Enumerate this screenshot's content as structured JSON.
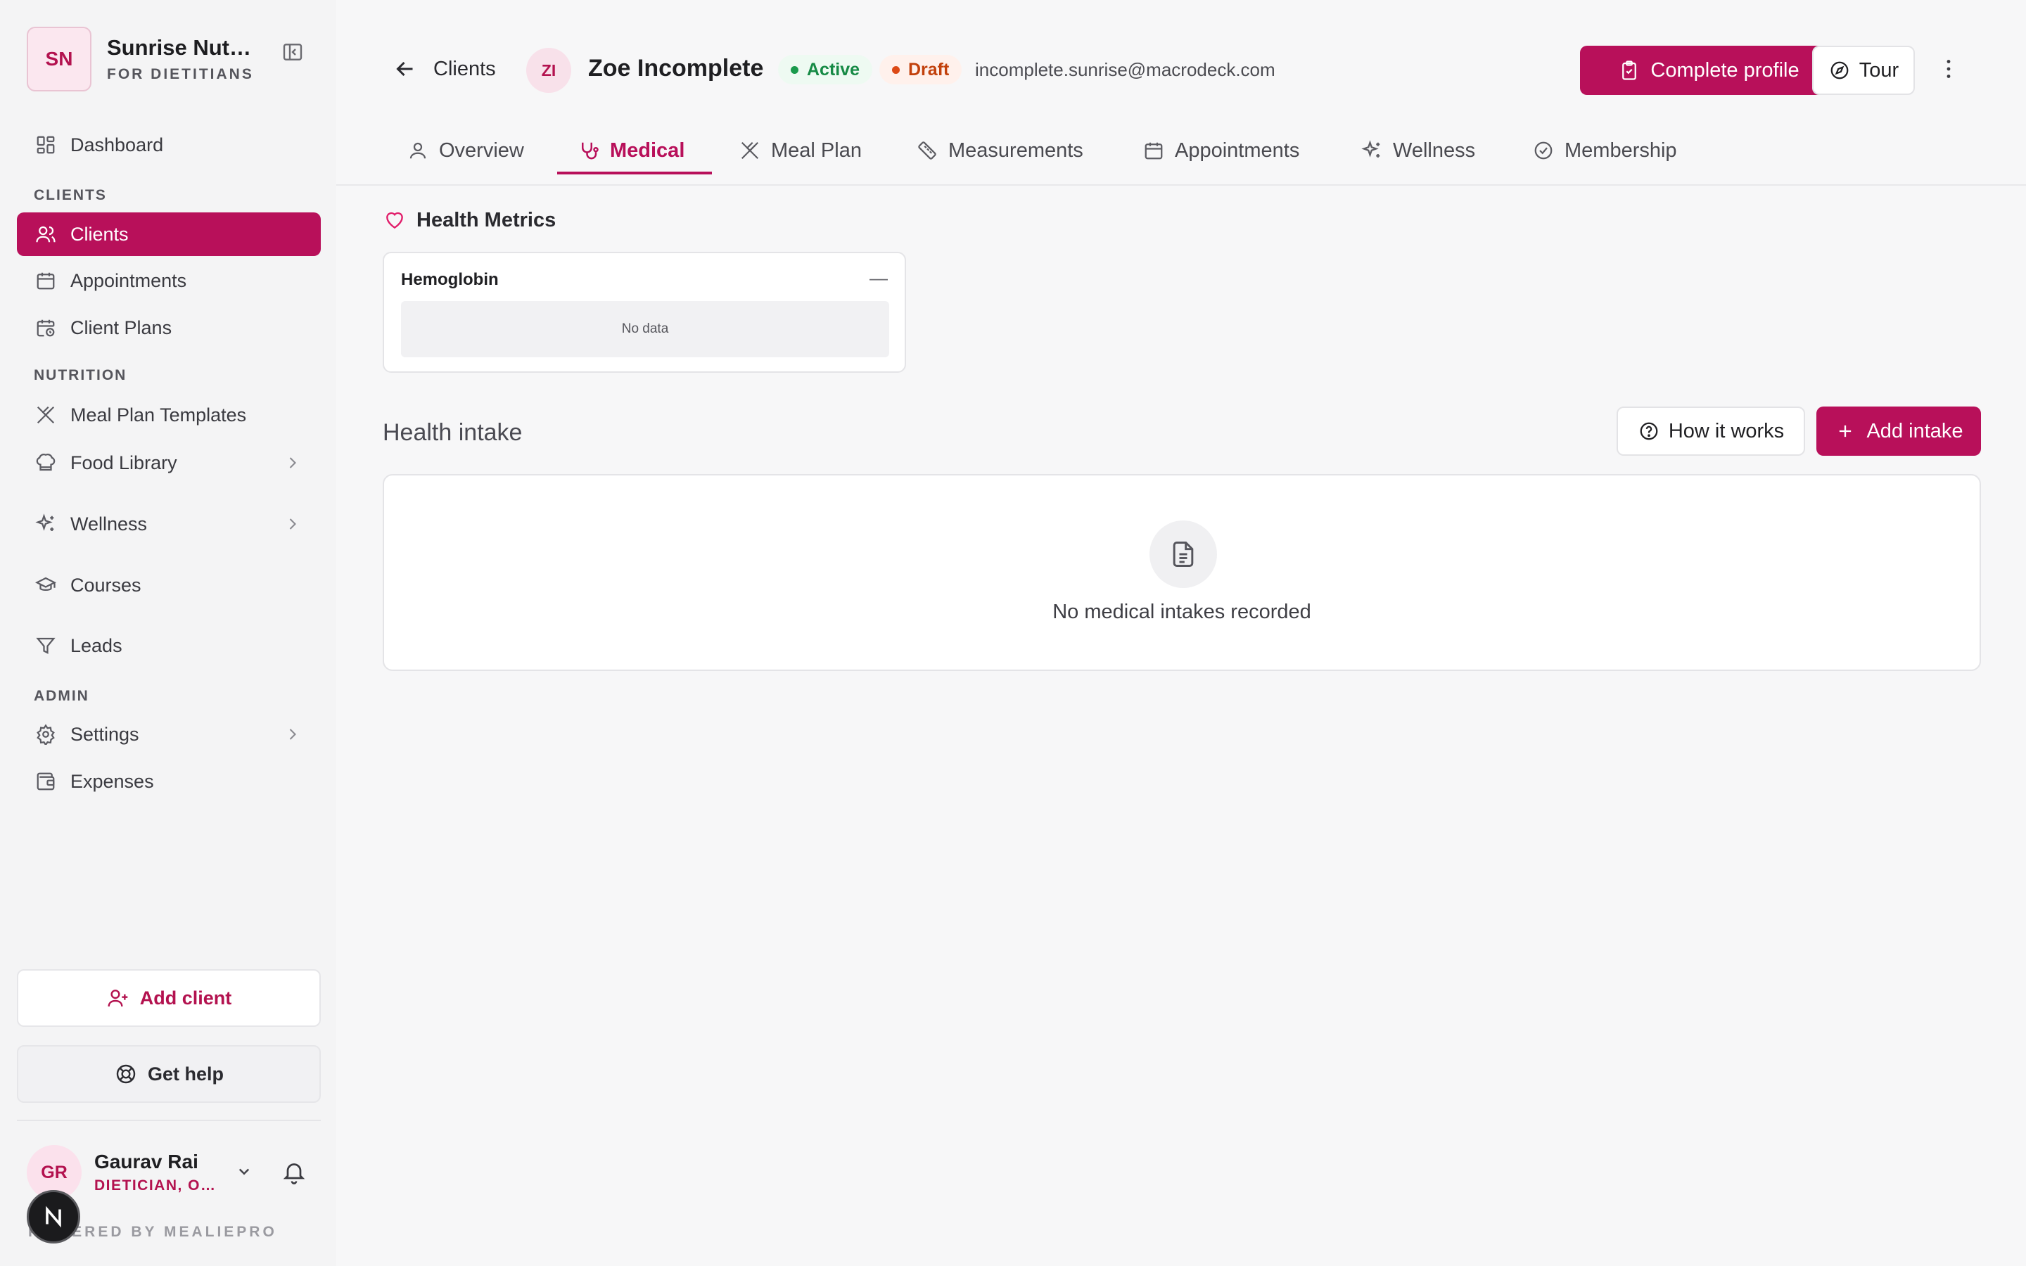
{
  "brand": {
    "initials": "SN",
    "name": "Sunrise Nutrition",
    "subtitle": "FOR DIETITIANS"
  },
  "sidebar": {
    "dashboard": "Dashboard",
    "sections": {
      "clients": "CLIENTS",
      "nutrition": "NUTRITION",
      "admin": "ADMIN"
    },
    "items": {
      "clients": "Clients",
      "appointments": "Appointments",
      "client_plans": "Client Plans",
      "meal_plan_templates": "Meal Plan Templates",
      "food_library": "Food Library",
      "wellness": "Wellness",
      "courses": "Courses",
      "leads": "Leads",
      "settings": "Settings",
      "expenses": "Expenses"
    },
    "add_client": "Add client",
    "get_help": "Get help"
  },
  "user": {
    "initials": "GR",
    "name": "Gaurav Rai",
    "role": "DIETICIAN, OWNER"
  },
  "powered_by": "POWERED BY MEALIEPRO",
  "header": {
    "breadcrumb": "Clients",
    "client": {
      "initials": "ZI",
      "name": "Zoe Incomplete",
      "status_active": "Active",
      "status_draft": "Draft",
      "email": "incomplete.sunrise@macrodeck.com"
    },
    "complete_profile": "Complete profile",
    "tour": "Tour"
  },
  "tabs": [
    "Overview",
    "Medical",
    "Meal Plan",
    "Measurements",
    "Appointments",
    "Wellness",
    "Membership"
  ],
  "health_metrics": {
    "title": "Health Metrics",
    "card": {
      "name": "Hemoglobin",
      "value": "—",
      "empty": "No data"
    }
  },
  "health_intake": {
    "title": "Health intake",
    "how_it_works": "How it works",
    "add_intake": "Add intake",
    "empty": "No medical intakes recorded"
  },
  "colors": {
    "accent": "#b8105a",
    "active_green": "#168a45",
    "draft_orange": "#c2410c"
  }
}
